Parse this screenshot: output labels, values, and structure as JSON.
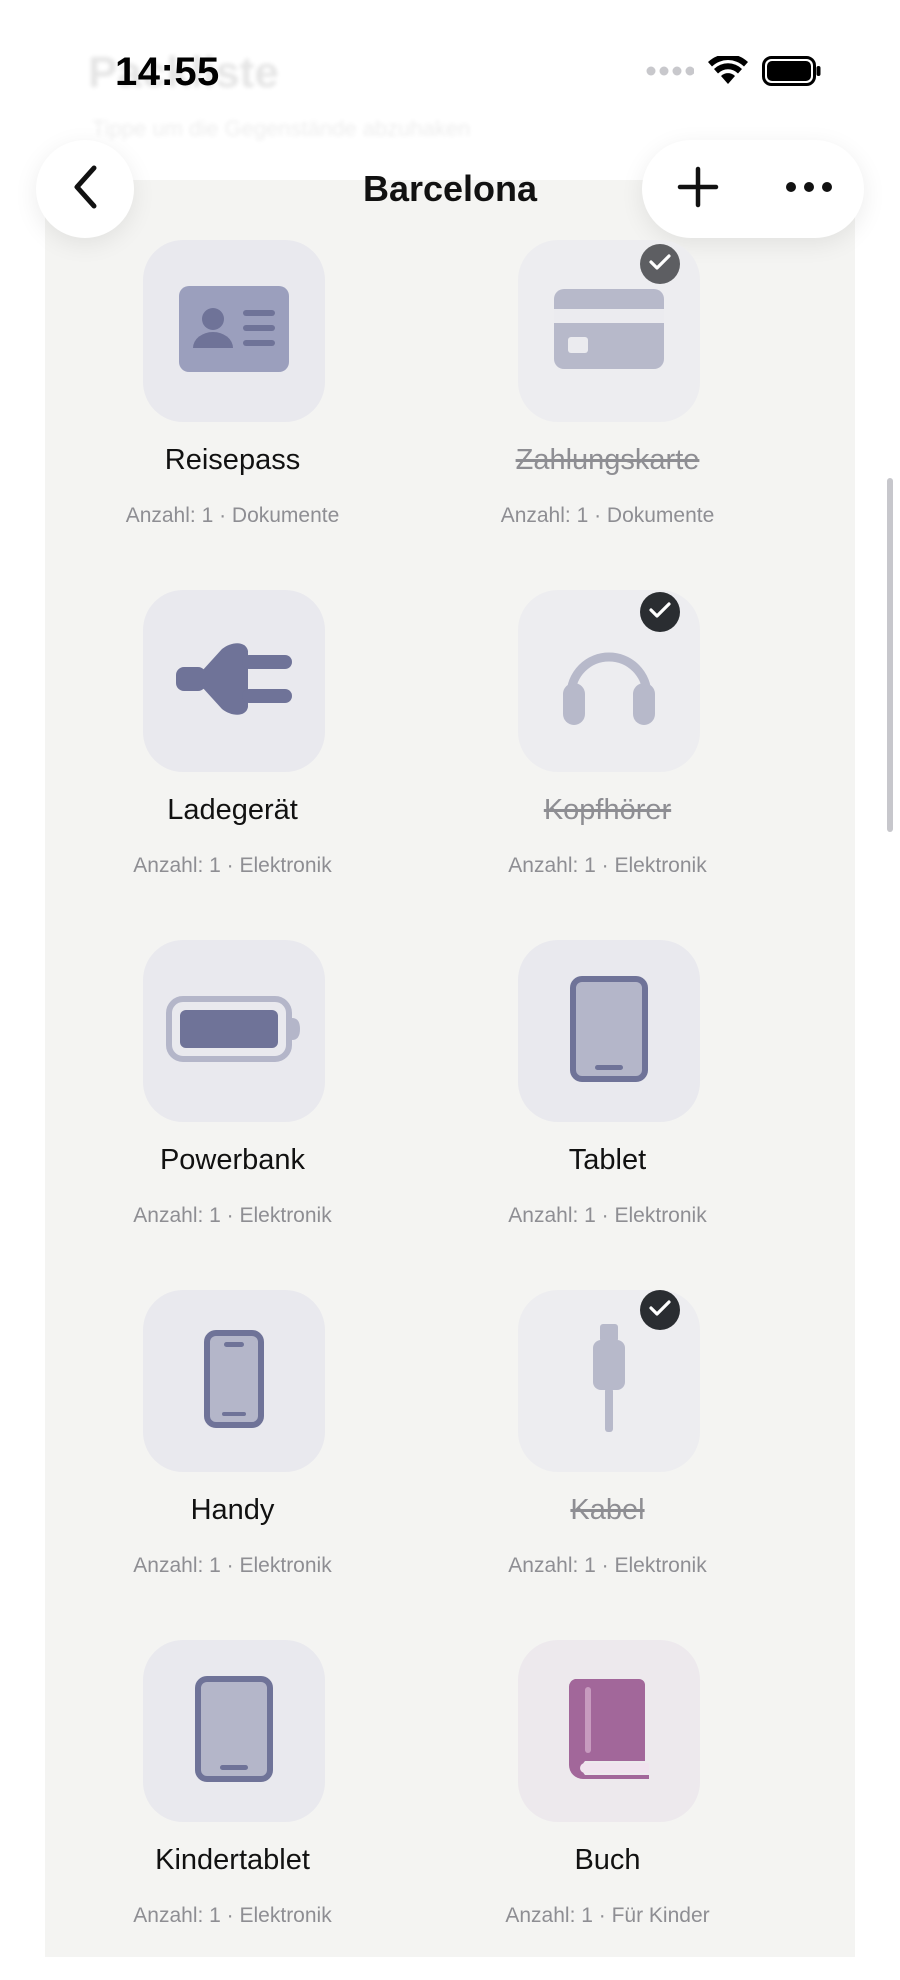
{
  "background": {
    "ghost_title": "Packliste",
    "ghost_subtitle": "Tippe um die Gegenstände abzuhaken"
  },
  "status_bar": {
    "time": "14:55",
    "icons": [
      "signal-icon",
      "wifi-icon",
      "battery-icon"
    ]
  },
  "nav": {
    "title": "Barcelona",
    "back_icon": "chevron-left-icon",
    "add_icon": "plus-icon",
    "more_icon": "ellipsis-icon"
  },
  "items": [
    {
      "name": "Reisepass",
      "meta": "Anzahl: 1 · Dokumente",
      "icon": "id-card-icon",
      "checked": false
    },
    {
      "name": "Zahlungskarte",
      "meta": "Anzahl: 1 · Dokumente",
      "icon": "credit-card-icon",
      "checked": true
    },
    {
      "name": "Ladegerät",
      "meta": "Anzahl: 1 · Elektronik",
      "icon": "plug-icon",
      "checked": false
    },
    {
      "name": "Kopfhörer",
      "meta": "Anzahl: 1 · Elektronik",
      "icon": "headphones-icon",
      "checked": true
    },
    {
      "name": "Powerbank",
      "meta": "Anzahl: 1 · Elektronik",
      "icon": "battery-pack-icon",
      "checked": false
    },
    {
      "name": "Tablet",
      "meta": "Anzahl: 1 · Elektronik",
      "icon": "tablet-icon",
      "checked": false
    },
    {
      "name": "Handy",
      "meta": "Anzahl: 1 · Elektronik",
      "icon": "phone-icon",
      "checked": false
    },
    {
      "name": "Kabel",
      "meta": "Anzahl: 1 · Elektronik",
      "icon": "cable-icon",
      "checked": true
    },
    {
      "name": "Kindertablet",
      "meta": "Anzahl: 1 · Elektronik",
      "icon": "tablet-icon",
      "checked": false
    },
    {
      "name": "Buch",
      "meta": "Anzahl: 1 · Für Kinder",
      "icon": "book-icon",
      "checked": false
    }
  ],
  "colors": {
    "icon_slate": "#6f7398",
    "icon_slate_light": "#b4b6c9",
    "book_pink": "#a2679a",
    "check_dark": "#2a2d31"
  }
}
